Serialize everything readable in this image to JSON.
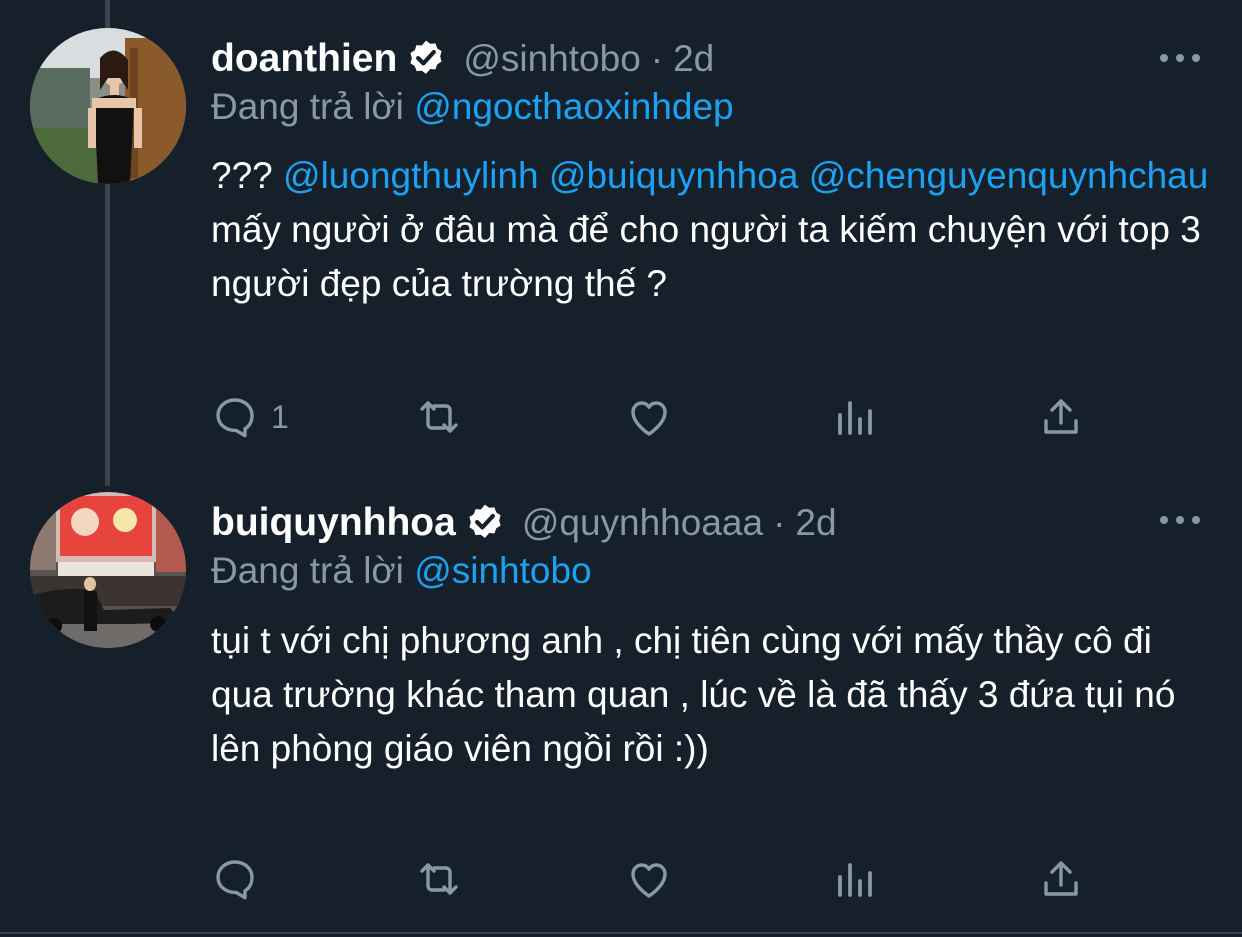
{
  "colors": {
    "background": "#15202b",
    "text": "#ffffff",
    "secondary": "#8899a6",
    "link": "#1da1f2",
    "divider": "#38444d"
  },
  "tweets": [
    {
      "display_name": "doanthien",
      "handle": "@sinhtobo",
      "separator": "·",
      "time": "2d",
      "reply_prefix": "Đang trả lời",
      "reply_to": "@ngocthaoxinhdep",
      "body": {
        "lead": "???",
        "mention_1": "@luongthuylinh",
        "mention_2": "@buiquynhhoa",
        "mention_3": "@chenguyenquynhchau",
        "text": "mấy người ở đâu mà để cho người ta kiếm chuyện với top 3 người đẹp của trường thế ?"
      },
      "reply_count": "1",
      "icons": [
        "reply-icon",
        "retweet-icon",
        "like-icon",
        "analytics-icon",
        "share-icon"
      ]
    },
    {
      "display_name": "buiquynhhoa",
      "handle": "@quynhhoaaa",
      "separator": "·",
      "time": "2d",
      "reply_prefix": "Đang trả lời",
      "reply_to": "@sinhtobo",
      "body": {
        "text": "tụi t với chị phương anh , chị tiên cùng với mấy thầy cô đi qua trường khác tham quan , lúc về là đã thấy 3 đứa tụi nó lên phòng giáo viên ngồi rồi :))"
      },
      "reply_count": "",
      "icons": [
        "reply-icon",
        "retweet-icon",
        "like-icon",
        "analytics-icon",
        "share-icon"
      ]
    }
  ]
}
